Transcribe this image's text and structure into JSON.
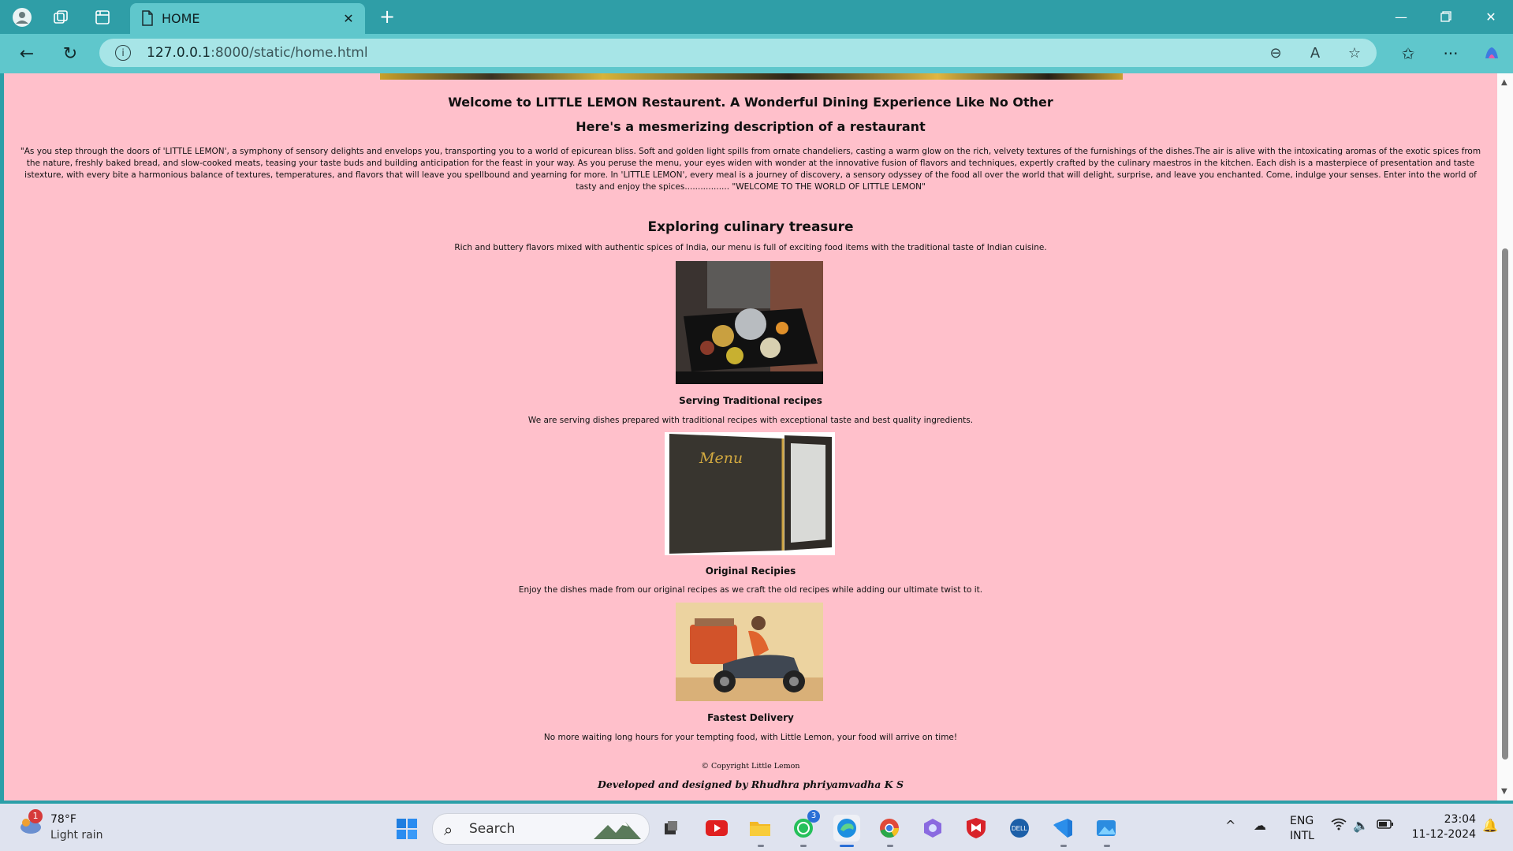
{
  "browser": {
    "tab_title": "HOME",
    "url_host": "127.0.0.1",
    "url_path": ":8000/static/home.html"
  },
  "page": {
    "welcome_heading": "Welcome to LITTLE LEMON Restaurent. A Wonderful Dining Experience Like No Other",
    "description_heading": "Here's a mesmerizing description of a restaurant",
    "description_paragraph": "\"As you step through the doors of 'LITTLE LEMON', a symphony of sensory delights and envelops you, transporting you to a world of epicurean bliss. Soft and golden light spills from ornate chandeliers, casting a warm glow on the rich, velvety textures of the furnishings of the dishes.The air is alive with the intoxicating aromas of the exotic spices from the nature, freshly baked bread, and slow-cooked meats, teasing your taste buds and building anticipation for the feast in your way. As you peruse the menu, your eyes widen with wonder at the innovative fusion of flavors and techniques, expertly crafted by the culinary maestros in the kitchen. Each dish is a masterpiece of presentation and taste istexture, with every bite a harmonious balance of textures, temperatures, and flavors that will leave you spellbound and yearning for more. In 'LITTLE LEMON', every meal is a journey of discovery, a sensory odyssey of the food all over the world that will delight, surprise, and leave you enchanted. Come, indulge your senses. Enter into the world of tasty and enjoy the spices................. \"WELCOME TO THE WORLD OF LITTLE LEMON\"",
    "explore_heading": "Exploring culinary treasure",
    "explore_text": "Rich and buttery flavors mixed with authentic spices of India, our menu is full of exciting food items with the traditional taste of Indian cuisine.",
    "features": [
      {
        "title": "Serving Traditional recipes",
        "text": "We are serving dishes prepared with traditional recipes with exceptional taste and best quality ingredients."
      },
      {
        "title": "Original Recipies",
        "text": "Enjoy the dishes made from our original recipes as we craft the old recipes while adding our ultimate twist to it."
      },
      {
        "title": "Fastest Delivery",
        "text": "No more waiting long hours for your tempting food, with Little Lemon, your food will arrive on time!"
      }
    ],
    "menu_image_text": "Menu",
    "copyright": "© Copyright Little Lemon",
    "developer": "Developed and designed by Rhudhra phriyamvadha K S"
  },
  "taskbar": {
    "weather_badge": "1",
    "weather_temp": "78°F",
    "weather_condition": "Light rain",
    "search_label": "Search",
    "whatsapp_badge": "3",
    "lang_line1": "ENG",
    "lang_line2": "INTL",
    "time": "23:04",
    "date": "11-12-2024"
  },
  "colors": {
    "page_background": "#ffc0cb",
    "browser_frame": "#2f9ea7",
    "address_bar": "#5fc7cc"
  },
  "icons": [
    "profile-icon",
    "workspaces-icon",
    "tab-actions-icon",
    "document-icon",
    "close-icon",
    "plus-icon",
    "minimize-icon",
    "restore-icon",
    "back-icon",
    "refresh-icon",
    "info-icon",
    "zoom-out-icon",
    "read-aloud-icon",
    "favorite-star-icon",
    "favorites-icon",
    "more-icon",
    "copilot-icon"
  ]
}
